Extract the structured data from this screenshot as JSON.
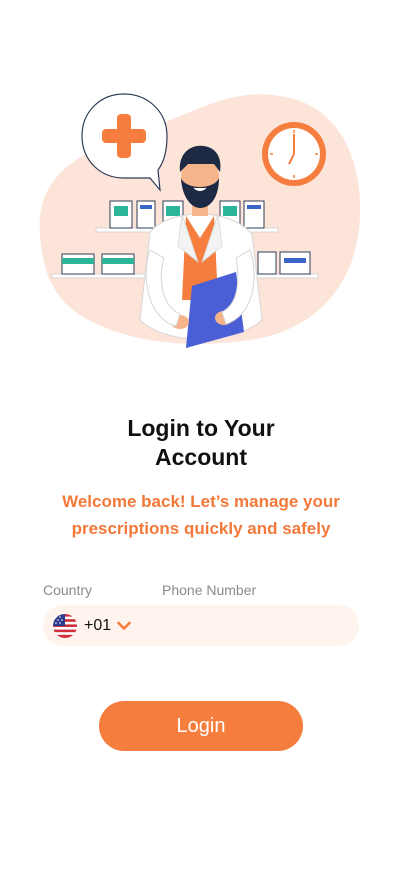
{
  "header": {
    "title_line1": "Login to Your",
    "title_line2": "Account",
    "subtitle": "Welcome back! Let’s manage your prescriptions quickly and safely"
  },
  "form": {
    "country_label": "Country",
    "phone_label": "Phone Number",
    "country_code": "+01",
    "country_flag_icon": "us-flag-icon",
    "phone_value": "",
    "phone_placeholder": ""
  },
  "actions": {
    "login_label": "Login"
  },
  "colors": {
    "accent": "#F57E3E",
    "blob": "#FDE4D8",
    "input_bg": "#FFF3EE",
    "title": "#111111"
  }
}
